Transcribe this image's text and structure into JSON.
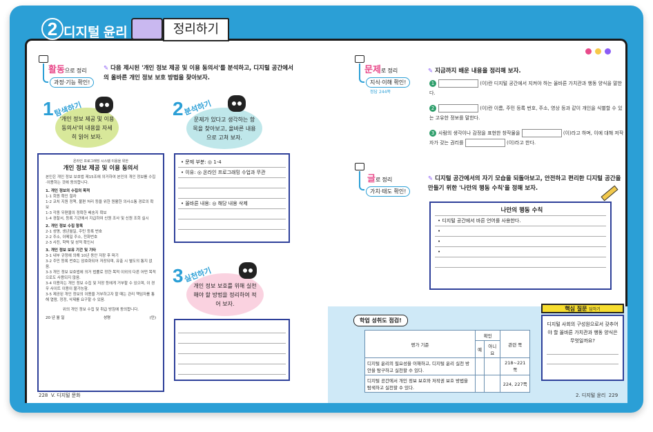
{
  "header": {
    "number": "2",
    "title": "디지털 윤리",
    "subtitle": "정리하기"
  },
  "activity": {
    "label": "활동",
    "label_suffix": "으로 정리",
    "pill": "과정·기능 확인!",
    "intro": "다음 제시된 '개인 정보 제공 및 이용 동의서'를 분석하고, 디지털 공간에서의 올바른 개인 정보 보호 방법을 찾아보자."
  },
  "steps": [
    {
      "num": "1",
      "label": "탐색하기",
      "bubble": "'개인 정보 제공 및 이용 동의서'의 내용을 자세히 읽어 보자."
    },
    {
      "num": "2",
      "label": "분석하기",
      "bubble": "문제가 있다고 생각하는 항목을 찾아보고, 올바른 내용으로 고쳐 보자."
    },
    {
      "num": "3",
      "label": "실천하기",
      "bubble": "개인 정보 보호를 위해 실천해야 할 방법을 정리하여 적어 보자."
    }
  ],
  "consent": {
    "sub": "온라인 프로그래밍 시스템 이용을 위한",
    "title": "개인 정보 제공 및 이용 동의서",
    "intro": "본인은 개인 정보 보호법 제15조에 의거하여 본인의 개인 정보를 수집·이용하는 것에 동의합니다.",
    "s1": "1. 개인 정보의 수집의 목적",
    "s1a": "1-1 회원 확인 절차",
    "s1b": "1-2 코치 지원 정책, 불편 처리 등을 위한 원활한 의사소통 경로의 확보",
    "s1c": "1-3 각종 우편물의 정확한 배송지 확보",
    "s1d": "1-4 경찰서, 등록 기관에서 지급하여 신원 조사 및 신원 조회 실시",
    "s2": "2. 개인 정보 수집 항목",
    "s2a": "2-1 성명, 생년월일, 주민 등록 번호",
    "s2b": "2-2 주소, 이메일 주소, 전화번호",
    "s2c": "2-3 사진, 학력 및 성적 확인서",
    "s3": "3. 개인 정보 보유 기간 및 기타",
    "s3a": "3-1 내부 규정에 의해 10년 동안 저장 후 파기",
    "s3b": "3-2 주민 등록 번호는 암호화되어 저장되며, 유출 시 별도의 통지 없음.",
    "s3c": "3-3 개인 정보 보호법에 의거 법률로 정한 목적 이외의 다른 어떤 목적으로도 사용되지 않음.",
    "s3d": "3-4 이용자는 개인 정보 수집 및 저장 등에게 거부할 수 있으며, 이 경우 사이트 이용이 불가능함.",
    "s3e": "3-5 제공된 개인 정보의 이용을 거부하고자 할 때는 관리 책임자를 통해 열람, 정정, 삭제를 요구할 수 있음.",
    "agree": "위의 개인 정보 수집 및 취급 방침에 동의합니다.",
    "date": "20   년   월   일",
    "name": "성명",
    "seal": "(인)"
  },
  "analysis": {
    "l1": "• 문제 부분: ◎ 1-4",
    "l2": "• 이유: ◎ 온라인 프로그래밍 수업과 무관",
    "l3": "• 올바른 내용: ◎ 해당 내용 삭제"
  },
  "problem": {
    "label": "문제",
    "label_suffix": "로 정리",
    "pill": "지식·이해 확인!",
    "ref": "정답 244쪽",
    "intro": "지금까지 배운 내용을 정리해 보자.",
    "q1": "(이)란 디지털 공간에서 지켜야 하는 올바른 가치관과 행동 양식을 말한다.",
    "q2": "(이)란 이름, 주민 등록 번호, 주소, 영상 등과 같이 개인을 식별할 수 있는 고유한 정보를 말한다.",
    "q3a": "사람의 생각이나 감정을 표현한 창작물을",
    "q3b": "(이)라고 하며, 이에 대해 저작자가 갖는 권리를",
    "q3c": "(이)라고 한다."
  },
  "writing": {
    "label": "글",
    "label_suffix": "로 정리",
    "pill": "가치·태도 확인!",
    "intro": "디지털 공간에서의 자기 모습을 되돌아보고, 안전하고 편리한 디지털 공간을 만들기 위한 '나만의 행동 수칙'을 정해 보자.",
    "box_title": "나만의 행동 수칙",
    "rule1": "• 디지털 공간에서 바른 언어를 사용한다.",
    "b2": "•",
    "b3": "•",
    "b4": "•"
  },
  "check": {
    "title": "학업 성취도 점검!",
    "col1": "평가 기준",
    "col2": "확인",
    "yes": "예",
    "no": "아니요",
    "col3": "관련 쪽",
    "r1": "디지털 윤리의 필요성을 이해하고, 디지털 윤리 실천 방안을 탐구하고 실천할 수 있다.",
    "r1p": "218~221쪽",
    "r2": "디지털 공간에서 개인 정보 보호와 저작권 보호 방법을 탐색하고 실천할 수 있다.",
    "r2p": "224, 227쪽"
  },
  "key": {
    "title": "핵심 질문",
    "sub": "답하기",
    "q": "디지털 사회의 구성원으로서 갖추어야 할 올바른 가치관과 행동 양식은 무엇일까요?"
  },
  "footer": {
    "lpage": "228",
    "lsec": "V. 디지털 문화",
    "rsec": "2. 디지털 윤리",
    "rpage": "229"
  },
  "colors": {
    "frame": "#2b9fd6",
    "pink": "#e84a8a",
    "navy": "#2d3f99",
    "yellow": "#f7dd2e",
    "green_bubble": "#d8e89a",
    "cyan_bubble": "#bfe7ea",
    "pink_bubble": "#fad2e0"
  }
}
